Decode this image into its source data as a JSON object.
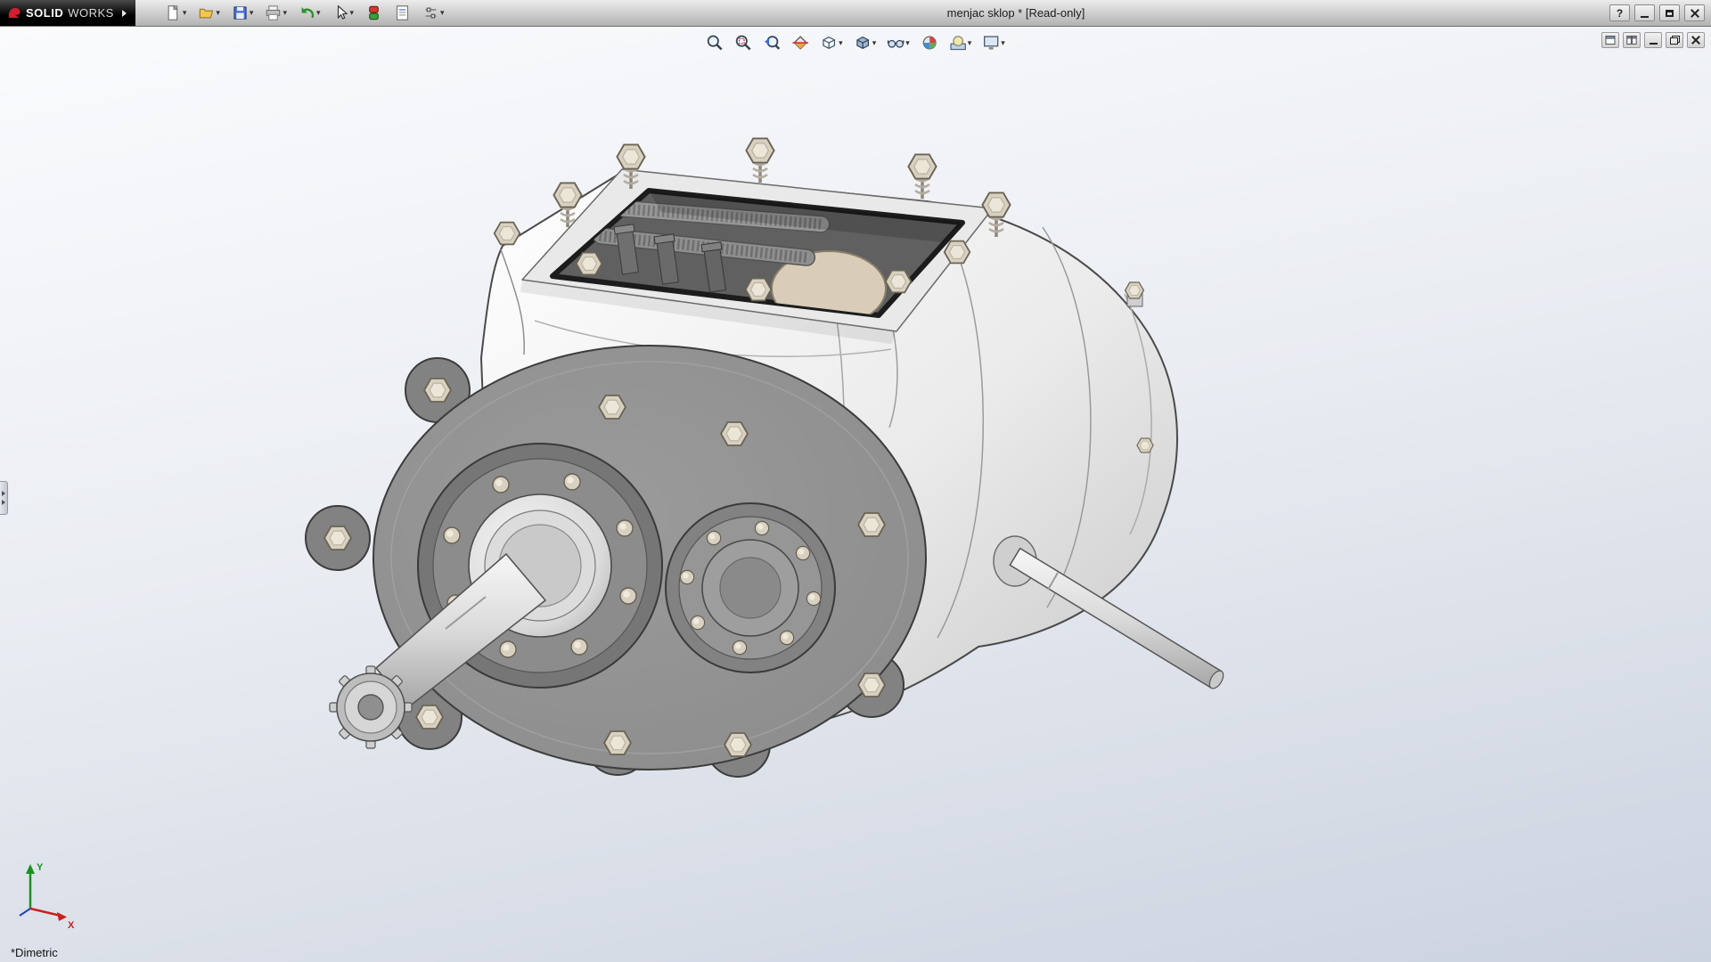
{
  "colors": {
    "accent_red": "#c8202e",
    "titlebar_top": "#ececec",
    "titlebar_bottom": "#b2b2b2",
    "viewport_top": "#fafbfd",
    "viewport_mid": "#eaedf2",
    "viewport_bottom": "#ccd3e0",
    "bolt": "#d8d1c1",
    "flange": "#8d8d8d",
    "triad_x": "#cc1f1f",
    "triad_y": "#18941c",
    "triad_z": "#2244bb"
  },
  "titlebar": {
    "brand_bold": "SOLID",
    "brand_light": "WORKS",
    "title": "menjac sklop * [Read-only]",
    "help_label": "?"
  },
  "main_toolbar": {
    "dropdown_glyph": "▾",
    "items": [
      {
        "name": "new-document",
        "icon": "new-document",
        "dropdown": true
      },
      {
        "name": "open",
        "icon": "open",
        "dropdown": true
      },
      {
        "name": "save",
        "icon": "save",
        "dropdown": true
      },
      {
        "name": "print",
        "icon": "print",
        "dropdown": true
      },
      {
        "name": "undo",
        "icon": "undo",
        "dropdown": true
      },
      {
        "name": "select",
        "icon": "select",
        "dropdown": true
      },
      {
        "name": "rebuild",
        "icon": "rebuild",
        "dropdown": false
      },
      {
        "name": "file-properties",
        "icon": "file-properties",
        "dropdown": false
      },
      {
        "name": "options",
        "icon": "options",
        "dropdown": true
      }
    ]
  },
  "headsup_toolbar": {
    "dropdown_glyph": "▾",
    "items": [
      {
        "name": "zoom-to-fit",
        "icon": "zoom-to-fit",
        "dropdown": false
      },
      {
        "name": "zoom-to-area",
        "icon": "zoom-to-area",
        "dropdown": false
      },
      {
        "name": "previous-view",
        "icon": "previous-view",
        "dropdown": false
      },
      {
        "name": "section-view",
        "icon": "section-view",
        "dropdown": false
      },
      {
        "name": "view-orientation",
        "icon": "view-orientation",
        "dropdown": true
      },
      {
        "name": "display-style",
        "icon": "display-style",
        "dropdown": true
      },
      {
        "name": "hide-show-items",
        "icon": "hide-show-items",
        "dropdown": true
      },
      {
        "name": "edit-appearance",
        "icon": "edit-appearance",
        "dropdown": false
      },
      {
        "name": "apply-scene",
        "icon": "apply-scene",
        "dropdown": true
      },
      {
        "name": "view-settings",
        "icon": "view-settings",
        "dropdown": true
      }
    ]
  },
  "viewport": {
    "view_label": "*Dimetric",
    "triad": {
      "x_label": "X",
      "y_label": "Y"
    }
  }
}
